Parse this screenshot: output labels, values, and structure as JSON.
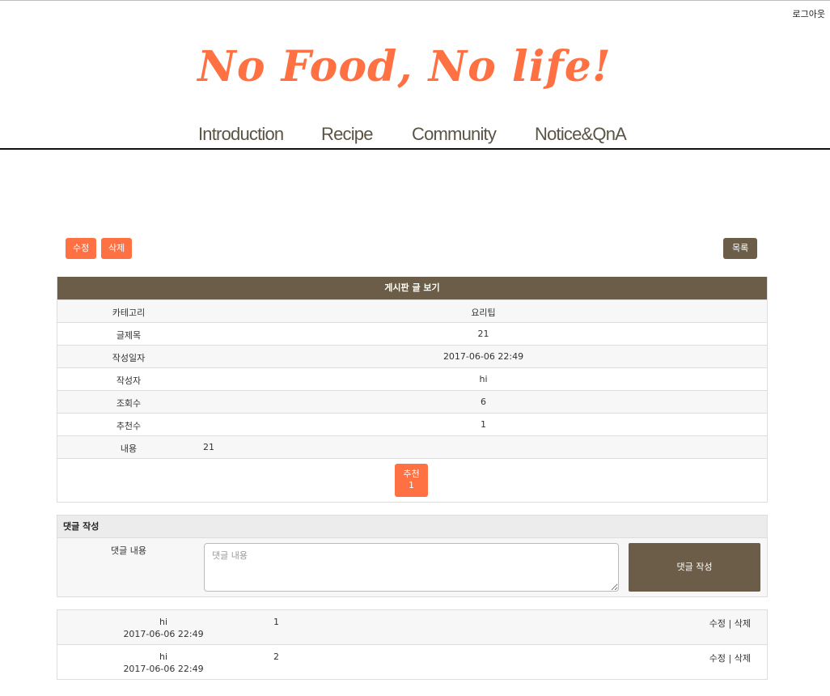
{
  "header": {
    "logout": "로그아웃",
    "logo": "No Food, No life!",
    "nav": [
      "Introduction",
      "Recipe",
      "Community",
      "Notice&QnA"
    ]
  },
  "actions": {
    "edit": "수정",
    "delete": "삭제",
    "list": "목록"
  },
  "board": {
    "title": "게시판 글 보기",
    "rows": [
      {
        "label": "카테고리",
        "value": "요리팁"
      },
      {
        "label": "글제목",
        "value": "21"
      },
      {
        "label": "작성일자",
        "value": "2017-06-06 22:49"
      },
      {
        "label": "작성자",
        "value": "hi"
      },
      {
        "label": "조회수",
        "value": "6"
      },
      {
        "label": "추천수",
        "value": "1"
      }
    ],
    "content": {
      "label": "내용",
      "value": "21"
    },
    "recommend": {
      "label": "추천",
      "count": "1"
    }
  },
  "comment_form": {
    "title": "댓글 작성",
    "label": "댓글 내용",
    "placeholder": "댓글 내용",
    "submit": "댓글 작성"
  },
  "comments": [
    {
      "author": "hi",
      "date": "2017-06-06 22:49",
      "text": "1",
      "edit": "수정",
      "sep": "|",
      "delete": "삭제"
    },
    {
      "author": "hi",
      "date": "2017-06-06 22:49",
      "text": "2",
      "edit": "수정",
      "sep": "|",
      "delete": "삭제"
    }
  ],
  "colors": {
    "accent": "#ff7043",
    "brown": "#6b5d47",
    "nav_text": "#5b5346"
  }
}
